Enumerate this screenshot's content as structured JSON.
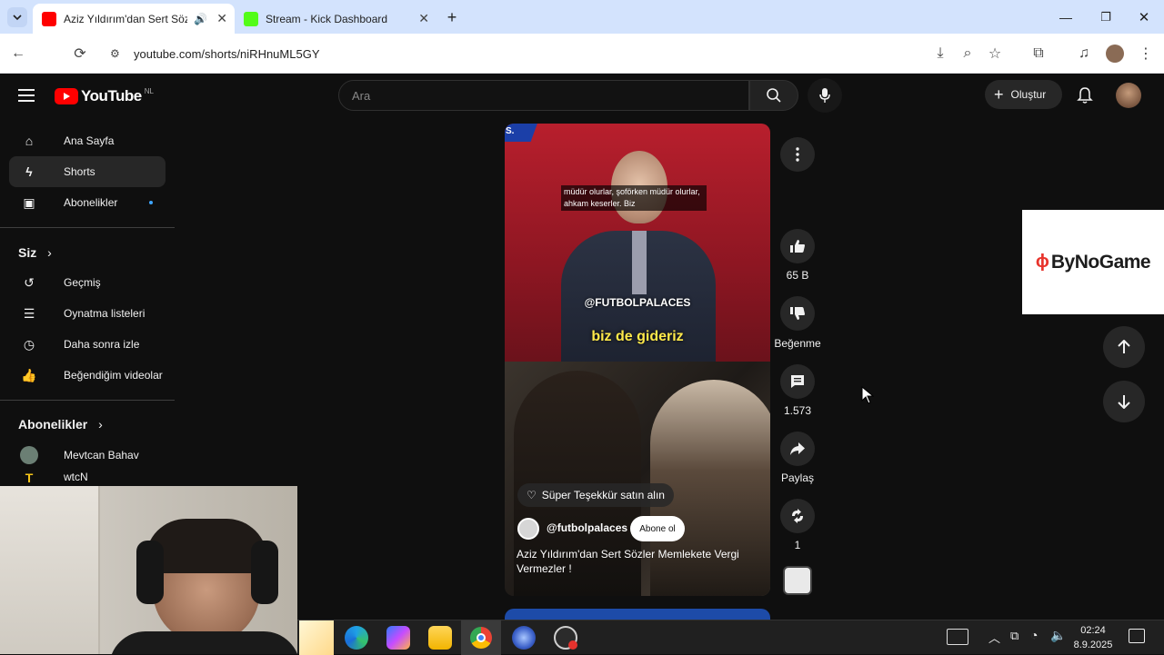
{
  "browser": {
    "tabs": [
      {
        "title": "Aziz Yıldırım'dan Sert Sözler",
        "active": true
      },
      {
        "title": "Stream - Kick Dashboard",
        "active": false
      }
    ],
    "url": "youtube.com/shorts/niRHnuML5GY"
  },
  "youtube": {
    "logo_text": "YouTube",
    "region": "NL",
    "search_placeholder": "Ara",
    "create_label": "Oluştur",
    "sidebar": {
      "main": [
        {
          "label": "Ana Sayfa",
          "icon": "home-icon"
        },
        {
          "label": "Shorts",
          "icon": "shorts-icon",
          "selected": true
        },
        {
          "label": "Abonelikler",
          "icon": "subscriptions-icon"
        }
      ],
      "you_title": "Siz",
      "you": [
        {
          "label": "Geçmiş",
          "icon": "history-icon"
        },
        {
          "label": "Oynatma listeleri",
          "icon": "playlist-icon"
        },
        {
          "label": "Daha sonra izle",
          "icon": "clock-icon"
        },
        {
          "label": "Beğendiğim videolar",
          "icon": "like-icon"
        }
      ],
      "subs_title": "Abonelikler",
      "subs": [
        {
          "label": "Mevtcan Bahav"
        },
        {
          "label": "wtcN"
        }
      ]
    },
    "short": {
      "subtitle_small": "müdür olurlar, şoförken müdür olurlar, ahkam keserler. Biz",
      "watermark": "@FUTBOLPALACES",
      "subtitle_big": "biz de gideriz",
      "corner_tag": "S.",
      "super_thanks": "Süper Teşekkür satın alın",
      "channel": "@futbolpalaces",
      "subscribe": "Abone ol",
      "title": "Aziz Yıldırım'dan Sert Sözler Memlekete Vergi Vermezler !"
    },
    "actions": {
      "likes": "65 B",
      "dislike": "Beğenme",
      "comments": "1.573",
      "share": "Paylaş",
      "remix": "1"
    },
    "ad_text": "ByNoGame"
  },
  "taskbar": {
    "time": "02:24",
    "date": "8.9.2025"
  },
  "colors": {
    "youtube_red": "#ff0000",
    "tab_bar": "#d3e3fd",
    "dark_bg": "#0f0f0f"
  }
}
